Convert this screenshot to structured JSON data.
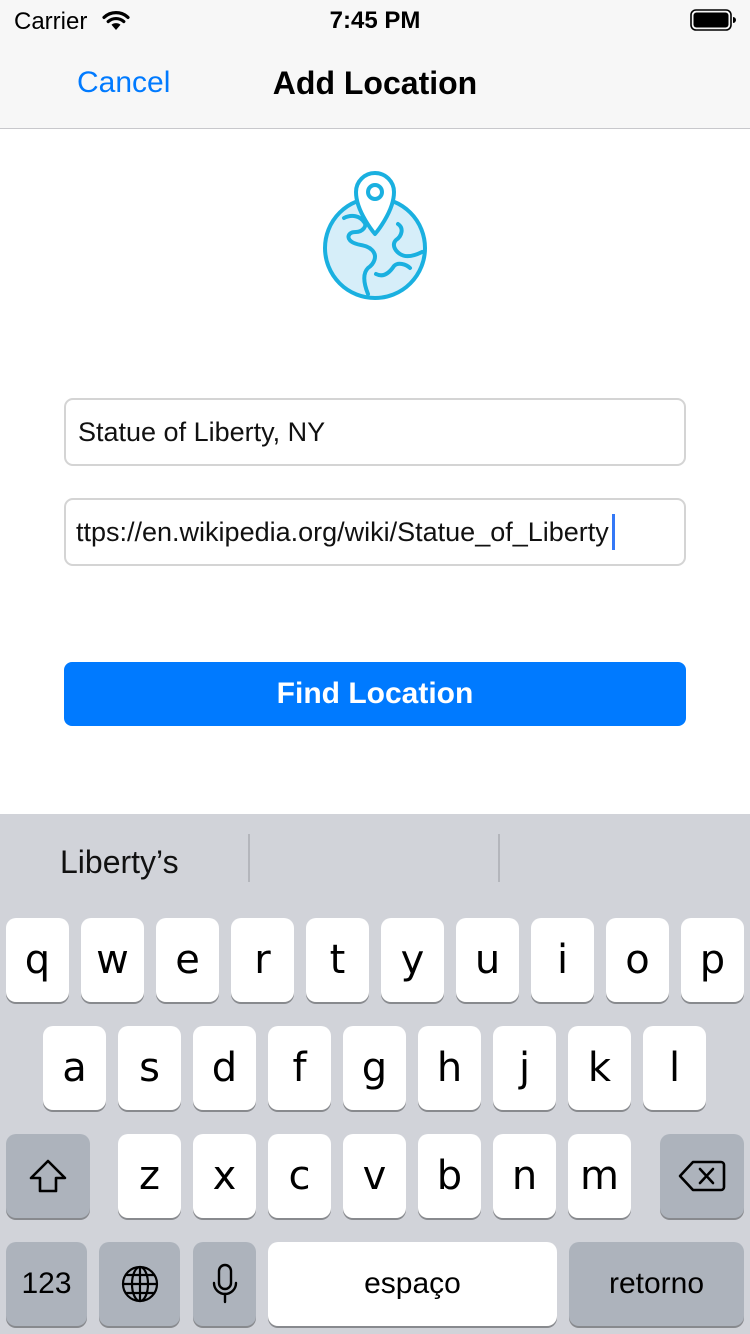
{
  "status_bar": {
    "carrier": "Carrier",
    "time": "7:45 PM"
  },
  "nav": {
    "cancel_label": "Cancel",
    "title": "Add Location"
  },
  "form": {
    "location_value": "Statue of Liberty, NY",
    "url_value": "ttps://en.wikipedia.org/wiki/Statue_of_Liberty",
    "find_button_label": "Find Location"
  },
  "keyboard": {
    "suggestions": [
      "Liberty’s",
      "",
      ""
    ],
    "row1": [
      "q",
      "w",
      "e",
      "r",
      "t",
      "y",
      "u",
      "i",
      "o",
      "p"
    ],
    "row2": [
      "a",
      "s",
      "d",
      "f",
      "g",
      "h",
      "j",
      "k",
      "l"
    ],
    "row3": [
      "z",
      "x",
      "c",
      "v",
      "b",
      "n",
      "m"
    ],
    "numbers_label": "123",
    "space_label": "espaço",
    "return_label": "retorno"
  },
  "colors": {
    "accent": "#007aff",
    "icon_blue": "#1ab0e0",
    "keyboard_bg": "#d1d3d9"
  },
  "icons": [
    "wifi-icon",
    "battery-icon",
    "globe-pin-icon",
    "shift-icon",
    "delete-icon",
    "globe-icon",
    "microphone-icon"
  ]
}
